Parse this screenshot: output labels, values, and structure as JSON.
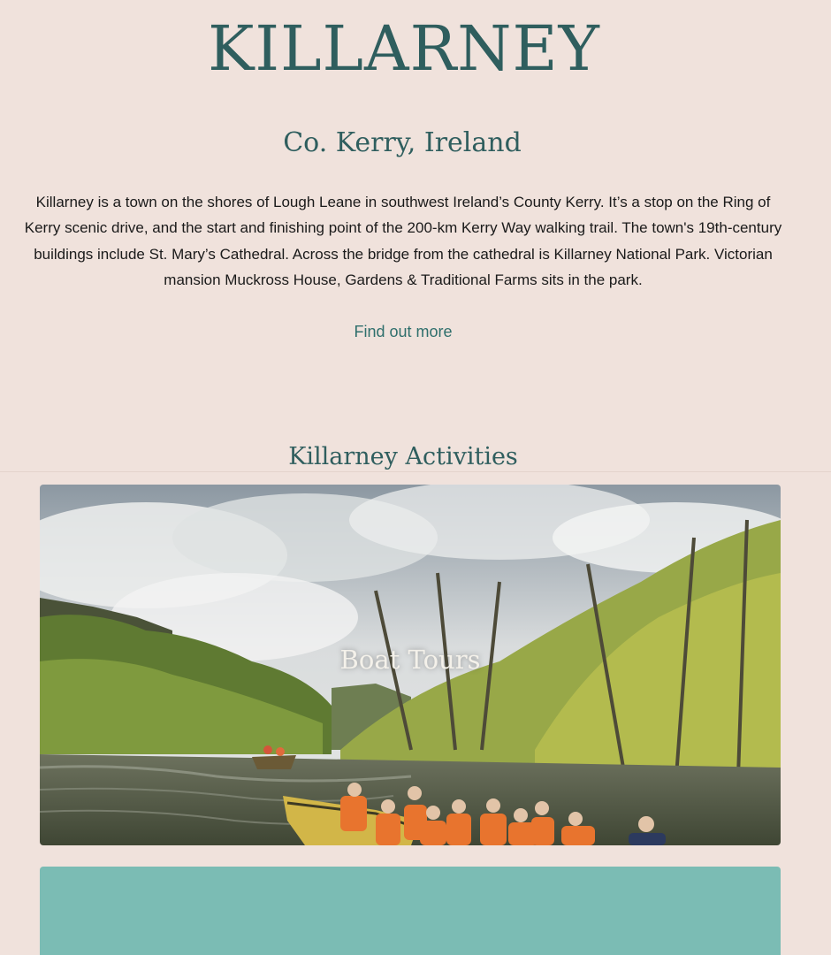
{
  "header": {
    "title": "KILLARNEY",
    "subtitle": "Co. Kerry, Ireland"
  },
  "intro": {
    "text": "Killarney is a town on the shores of Lough Leane in southwest Ireland’s County Kerry. It’s a stop on the Ring of Kerry scenic drive, and the start and finishing point of the 200-km Kerry Way walking trail. The town's 19th-century buildings include St. Mary’s Cathedral. Across the bridge from the cathedral is Killarney National Park. Victorian mansion Muckross House, Gardens & Traditional Farms sits in the park.",
    "link_label": "Find out more"
  },
  "activities": {
    "section_title": "Killarney Activities",
    "cards": [
      {
        "label": "Boat Tours"
      }
    ]
  },
  "colors": {
    "background": "#f0e2dc",
    "heading": "#2f5e5e",
    "link": "#2f6f6c",
    "panel": "#7bbcb4"
  }
}
